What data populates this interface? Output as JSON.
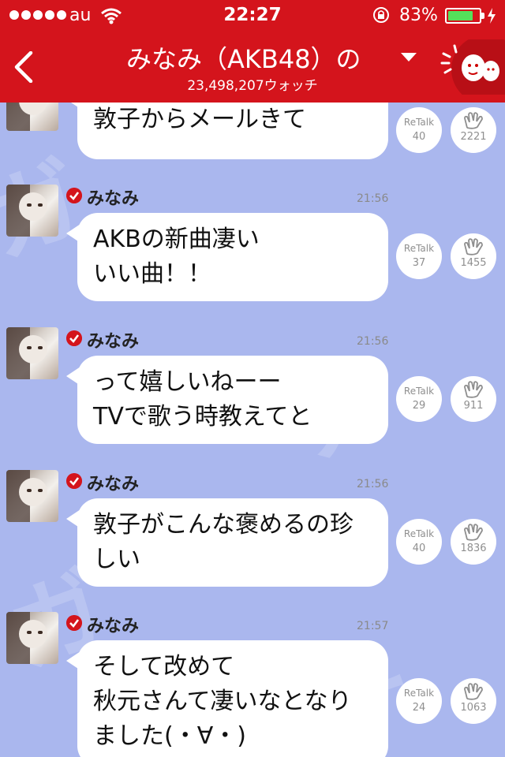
{
  "status_bar": {
    "carrier": "au",
    "time": "22:27",
    "battery_percent": "83%",
    "battery_level": 0.83,
    "icons": [
      "signal-dots-icon",
      "wifi-icon",
      "orientation-lock-icon",
      "battery-icon",
      "charging-bolt-icon"
    ]
  },
  "header": {
    "title": "みなみ（AKB48）の",
    "watch_count": "23,498,207ウォッチ",
    "icons": [
      "back-chevron-icon",
      "dropdown-triangle-icon",
      "mascot-icon"
    ]
  },
  "colors": {
    "header": "#d4141c",
    "chat_background": "#aab7ee",
    "bubble": "#ffffff",
    "verified": "#d4141c",
    "battery_fill": "#55e05a"
  },
  "messages": [
    {
      "continued": true,
      "lines": [
        "敦子からメールきて"
      ],
      "retalk_label": "ReTalk",
      "retalk_count": "40",
      "clap_count": "2221"
    },
    {
      "name": "みなみ",
      "time": "21:56",
      "lines": [
        "AKBの新曲凄い",
        "いい曲！！"
      ],
      "retalk_label": "ReTalk",
      "retalk_count": "37",
      "clap_count": "1455"
    },
    {
      "name": "みなみ",
      "time": "21:56",
      "lines": [
        "って嬉しいねーー",
        "TVで歌う時教えてと"
      ],
      "retalk_label": "ReTalk",
      "retalk_count": "29",
      "clap_count": "911"
    },
    {
      "name": "みなみ",
      "time": "21:56",
      "lines": [
        "敦子がこんな褒めるの珍",
        "しい"
      ],
      "retalk_label": "ReTalk",
      "retalk_count": "40",
      "clap_count": "1836"
    },
    {
      "name": "みなみ",
      "time": "21:57",
      "lines": [
        "そして改めて",
        "秋元さんて凄いなとなり",
        "ました(・∀・)"
      ],
      "retalk_label": "ReTalk",
      "retalk_count": "24",
      "clap_count": "1063"
    }
  ]
}
